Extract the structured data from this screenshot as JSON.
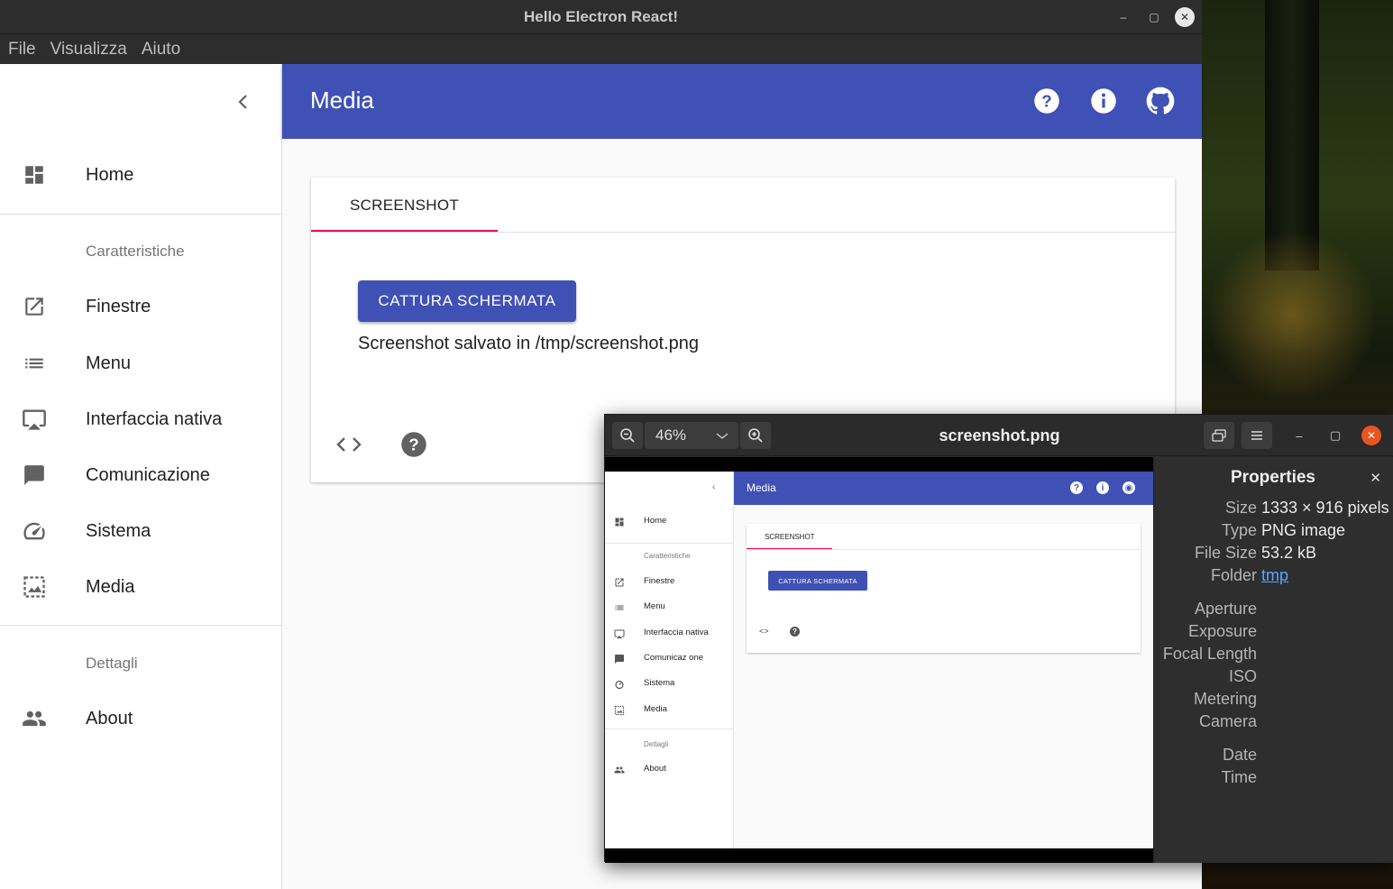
{
  "window": {
    "title": "Hello Electron React!",
    "controls": [
      "–",
      "▢",
      "✕"
    ]
  },
  "menubar": [
    "File",
    "Visualizza",
    "Aiuto"
  ],
  "sidebar": {
    "items": [
      {
        "label": "Home",
        "icon": "dashboard-icon"
      },
      {
        "label": "Finestre",
        "icon": "open-in-new-icon"
      },
      {
        "label": "Menu",
        "icon": "list-icon"
      },
      {
        "label": "Interfaccia nativa",
        "icon": "airplay-icon"
      },
      {
        "label": "Comunicazione",
        "icon": "chat-icon"
      },
      {
        "label": "Sistema",
        "icon": "speedometer-icon"
      },
      {
        "label": "Media",
        "icon": "image-frame-icon"
      },
      {
        "label": "About",
        "icon": "people-icon"
      }
    ],
    "sections": [
      "Caratteristiche",
      "Dettagli"
    ]
  },
  "appbar": {
    "title": "Media",
    "actions": [
      "help-icon",
      "info-icon",
      "github-icon"
    ],
    "color": "#3f51b5"
  },
  "card": {
    "tab": "SCREENSHOT",
    "button": "CATTURA SCHERMATA",
    "status": "Screenshot salvato in /tmp/screenshot.png",
    "accent": "#f50057"
  },
  "viewer": {
    "title": "screenshot.png",
    "zoom": "46%",
    "properties_title": "Properties",
    "properties": [
      {
        "key": "Size",
        "value": "1333 × 916 pixels"
      },
      {
        "key": "Type",
        "value": "PNG image"
      },
      {
        "key": "File Size",
        "value": "53.2 kB"
      },
      {
        "key": "Folder",
        "value": "tmp"
      }
    ],
    "exif": [
      "Aperture",
      "Exposure",
      "Focal Length",
      "ISO",
      "Metering",
      "Camera"
    ],
    "datetime": [
      "Date",
      "Time"
    ],
    "thumbnail": {
      "title": "Media",
      "tab": "SCREENSHOT",
      "button": "CATTURA SCHERMATA",
      "nav": [
        "Home",
        "Finestre",
        "Menu",
        "Interfaccia nativa",
        "Comunicaz one",
        "Sistema",
        "Media",
        "About"
      ],
      "sections": [
        "Caratteristiche",
        "Dettagli"
      ]
    }
  }
}
